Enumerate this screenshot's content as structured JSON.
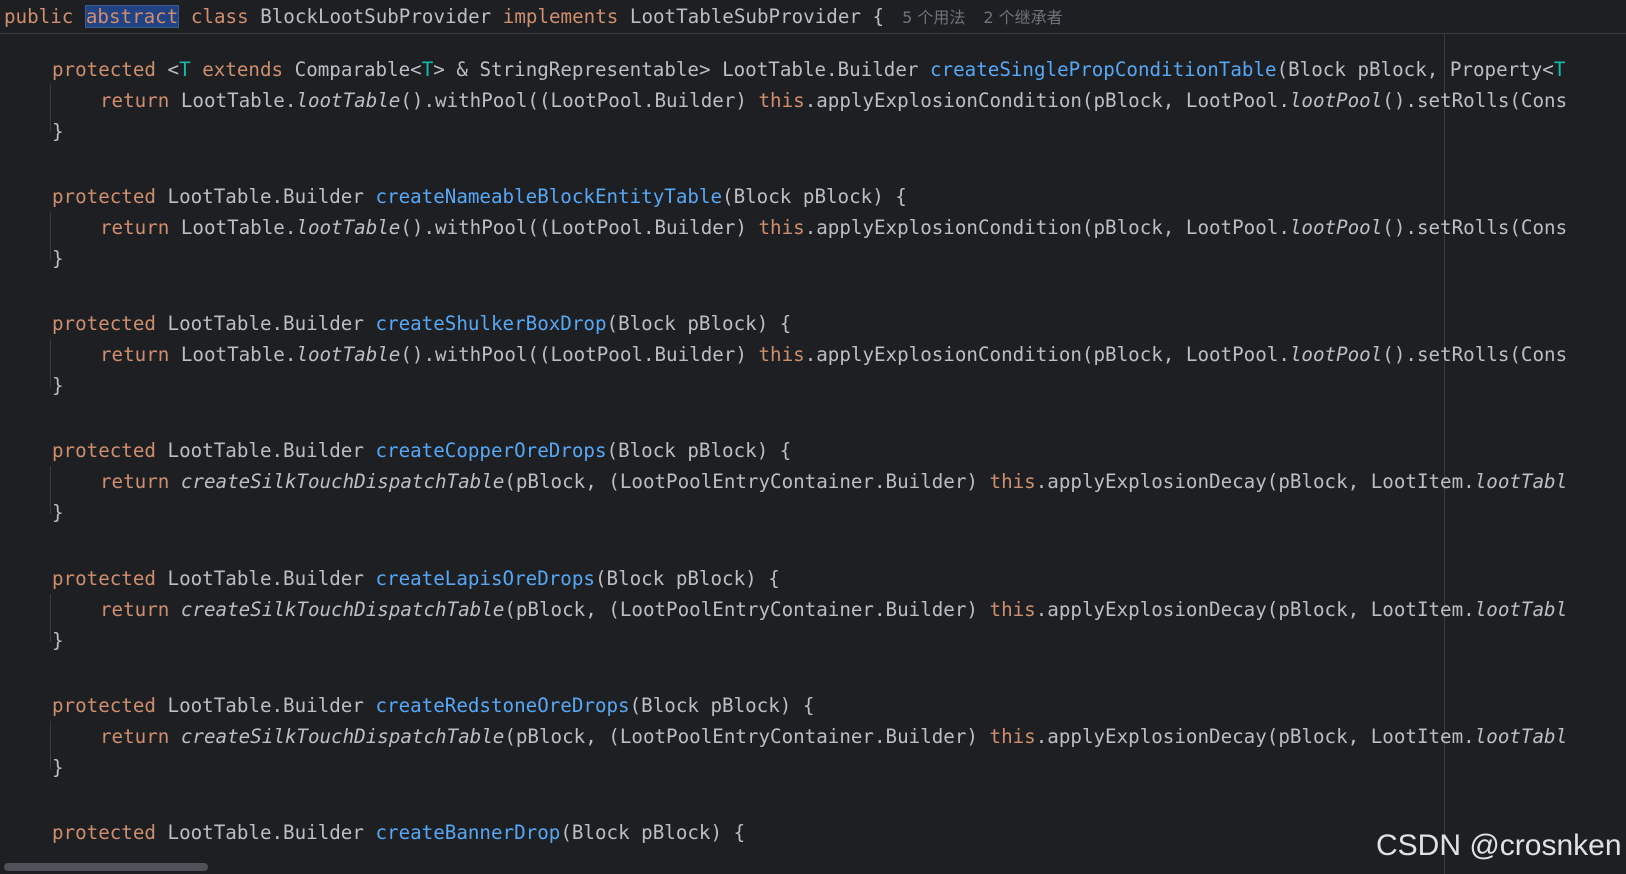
{
  "header": {
    "kw_public": "public",
    "kw_abstract": "abstract",
    "kw_class": "class",
    "class_name": "BlockLootSubProvider",
    "kw_implements": "implements",
    "interface_name": "LootTableSubProvider",
    "open_brace": "{",
    "usages_hint": "5 个用法",
    "inheritors_hint": "2 个继承者"
  },
  "methods": [
    {
      "sig_pre": "LootTable.Builder ",
      "generic": {
        "lt": "<",
        "t": "T",
        "kw_extends": "extends",
        "mid": " Comparable<",
        "t2": "T",
        "rest": "> & StringRepresentable> "
      },
      "name": "createSinglePropConditionTable",
      "params": "(Block pBlock, Property<",
      "params_tail_type": "T",
      "body": {
        "return": "return",
        "pre": " LootTable.",
        "italic1": "lootTable",
        "mid1": "().withPool((LootPool.Builder) ",
        "this": "this",
        "mid2": ".applyExplosionCondition(pBlock, LootPool.",
        "italic2": "lootPool",
        "tail": "().setRolls(Cons"
      }
    },
    {
      "sig_pre": "LootTable.Builder ",
      "name": "createNameableBlockEntityTable",
      "params": "(Block pBlock) {",
      "body": {
        "return": "return",
        "pre": " LootTable.",
        "italic1": "lootTable",
        "mid1": "().withPool((LootPool.Builder) ",
        "this": "this",
        "mid2": ".applyExplosionCondition(pBlock, LootPool.",
        "italic2": "lootPool",
        "tail": "().setRolls(Cons"
      }
    },
    {
      "sig_pre": "LootTable.Builder ",
      "name": "createShulkerBoxDrop",
      "params": "(Block pBlock) {",
      "body": {
        "return": "return",
        "pre": " LootTable.",
        "italic1": "lootTable",
        "mid1": "().withPool((LootPool.Builder) ",
        "this": "this",
        "mid2": ".applyExplosionCondition(pBlock, LootPool.",
        "italic2": "lootPool",
        "tail": "().setRolls(Cons"
      }
    },
    {
      "sig_pre": "LootTable.Builder ",
      "name": "createCopperOreDrops",
      "params": "(Block pBlock) {",
      "body": {
        "return": "return",
        "italic1": "createSilkTouchDispatchTable",
        "mid1": "(pBlock, (LootPoolEntryContainer.Builder) ",
        "this": "this",
        "mid2": ".applyExplosionDecay(pBlock, LootItem.",
        "italic2": "lootTabl"
      }
    },
    {
      "sig_pre": "LootTable.Builder ",
      "name": "createLapisOreDrops",
      "params": "(Block pBlock) {",
      "body": {
        "return": "return",
        "italic1": "createSilkTouchDispatchTable",
        "mid1": "(pBlock, (LootPoolEntryContainer.Builder) ",
        "this": "this",
        "mid2": ".applyExplosionDecay(pBlock, LootItem.",
        "italic2": "lootTabl"
      }
    },
    {
      "sig_pre": "LootTable.Builder ",
      "name": "createRedstoneOreDrops",
      "params": "(Block pBlock) {",
      "body": {
        "return": "return",
        "italic1": "createSilkTouchDispatchTable",
        "mid1": "(pBlock, (LootPoolEntryContainer.Builder) ",
        "this": "this",
        "mid2": ".applyExplosionDecay(pBlock, LootItem.",
        "italic2": "lootTabl"
      }
    },
    {
      "sig_pre": "LootTable.Builder ",
      "name": "createBannerDrop",
      "params": "(Block pBlock) {"
    }
  ],
  "kw_protected": "protected",
  "close_brace": "}",
  "watermark": "CSDN @crosnken",
  "colors": {
    "background": "#1e1f22",
    "text": "#bcbec4",
    "keyword": "#cf8e6d",
    "method_decl": "#56a8f5",
    "type_param": "#16baac",
    "hint": "#6f737a",
    "selection": "#214283"
  }
}
